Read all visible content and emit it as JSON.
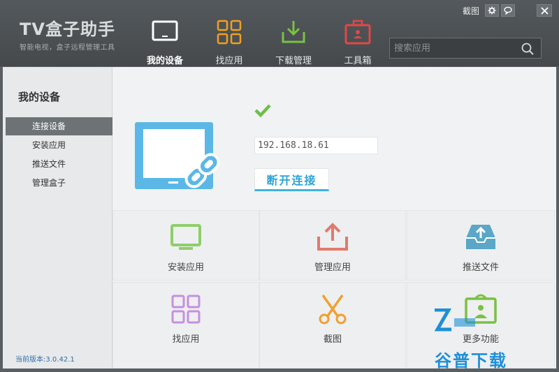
{
  "app": {
    "logo_title": "TV盒子助手",
    "logo_subtitle": "智能电视，盒子远程管理工具"
  },
  "titlebar": {
    "screenshot_label": "截图",
    "buttons": [
      "gear-icon",
      "speech-bubble-icon",
      "close-icon"
    ]
  },
  "nav": {
    "items": [
      {
        "label": "我的设备",
        "icon": "monitor-icon",
        "color": "#ffffff",
        "active": true
      },
      {
        "label": "找应用",
        "icon": "grid-icon",
        "color": "#f0a020",
        "active": false
      },
      {
        "label": "下载管理",
        "icon": "download-icon",
        "color": "#7ac143",
        "active": false
      },
      {
        "label": "工具箱",
        "icon": "toolbox-icon",
        "color": "#e04848",
        "active": false
      }
    ]
  },
  "search": {
    "placeholder": "搜索应用",
    "value": ""
  },
  "sidebar": {
    "title": "我的设备",
    "items": [
      {
        "label": "连接设备",
        "active": true
      },
      {
        "label": "安装应用",
        "active": false
      },
      {
        "label": "推送文件",
        "active": false
      },
      {
        "label": "管理盒子",
        "active": false
      }
    ],
    "version": "当前版本:3.0.42.1"
  },
  "device": {
    "ip": "192.168.18.61",
    "disconnect_label": "断开连接",
    "status_color": "#6cbf4a",
    "device_color": "#5bb8e6"
  },
  "tiles": [
    {
      "label": "安装应用",
      "icon": "monitor-icon",
      "color": "#8dcf6a"
    },
    {
      "label": "管理应用",
      "icon": "upload-icon",
      "color": "#e07a6e"
    },
    {
      "label": "推送文件",
      "icon": "inbox-upload-icon",
      "color": "#5aa7c7"
    },
    {
      "label": "找应用",
      "icon": "grid-icon",
      "color": "#c490e0"
    },
    {
      "label": "截图",
      "icon": "scissors-icon",
      "color": "#f0a030"
    },
    {
      "label": "更多功能",
      "icon": "person-board-icon",
      "color": "#7ac143"
    }
  ],
  "watermark": {
    "text": "谷普下载"
  }
}
